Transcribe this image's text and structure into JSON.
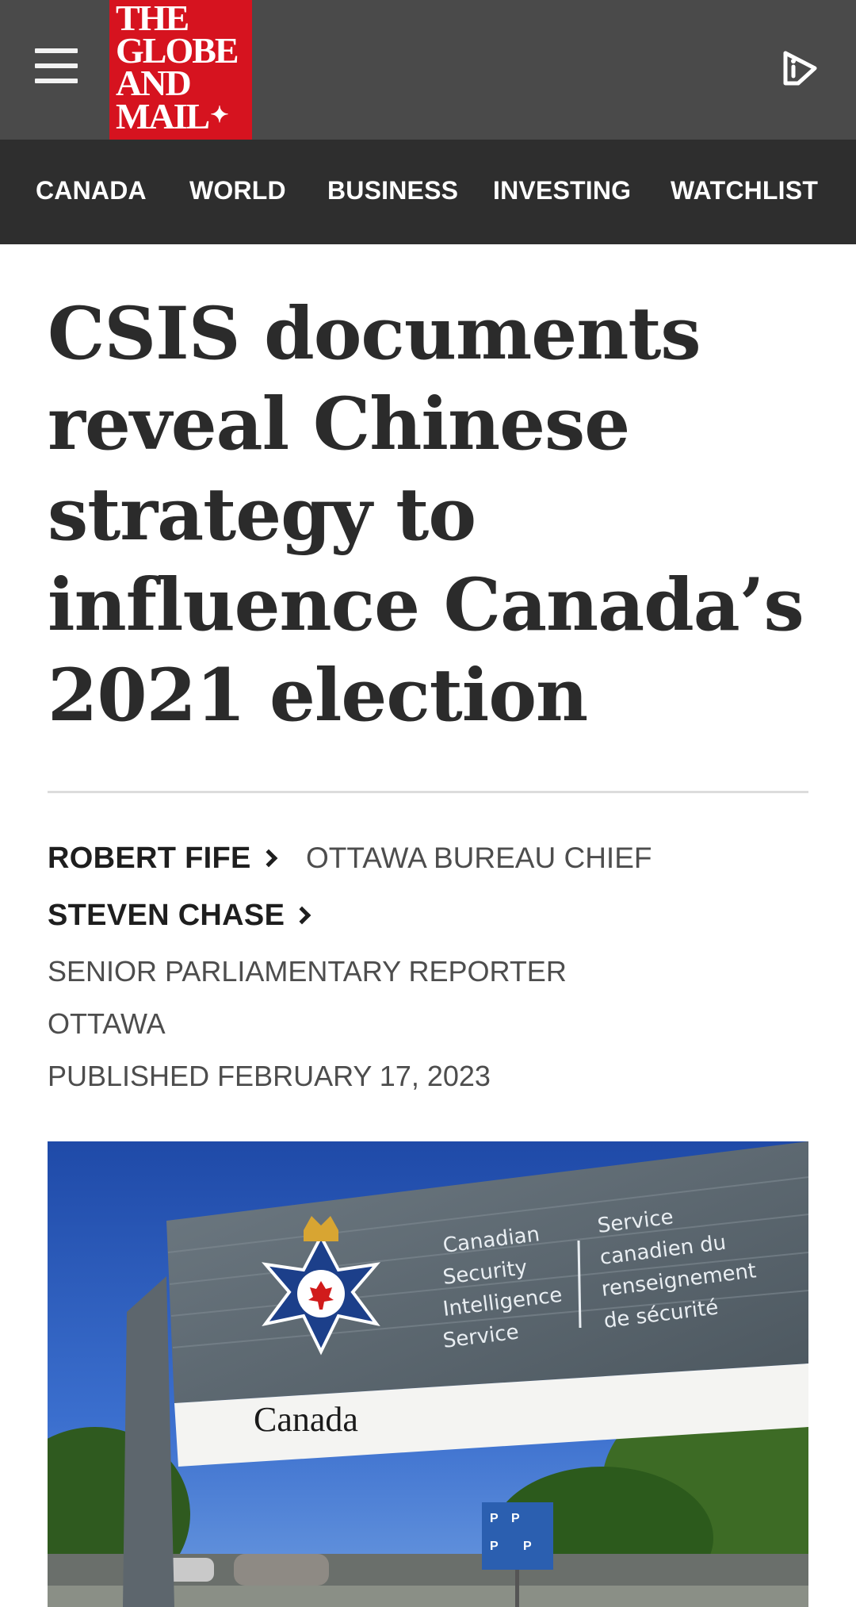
{
  "header": {
    "logo_lines": [
      "THE",
      "GLOBE",
      "AND",
      "MAIL"
    ],
    "logo_leaf": "✦",
    "menu_icon": "hamburger-menu-icon",
    "play_icon": "video-play-icon"
  },
  "nav": {
    "items": [
      "CANADA",
      "WORLD",
      "BUSINESS",
      "INVESTING",
      "WATCHLIST"
    ]
  },
  "article": {
    "headline": "CSIS documents reveal Chinese strategy to influence Canada’s 2021 election",
    "authors": [
      {
        "name": "ROBERT FIFE",
        "role": "OTTAWA BUREAU CHIEF"
      },
      {
        "name": "STEVEN CHASE",
        "role": "SENIOR PARLIAMENTARY REPORTER"
      }
    ],
    "location": "OTTAWA",
    "published": "PUBLISHED FEBRUARY 17, 2023"
  },
  "photo": {
    "sign_left": [
      "Canadian",
      "Security",
      "Intelligence",
      "Service"
    ],
    "sign_right": [
      "Service",
      "canadien du",
      "renseignement",
      "de sécurité"
    ],
    "wordmark": "Canada",
    "parking": "P"
  },
  "colors": {
    "topbar": "#4a4a4a",
    "navbar": "#2e2e2e",
    "logo_red": "#d6131f"
  }
}
